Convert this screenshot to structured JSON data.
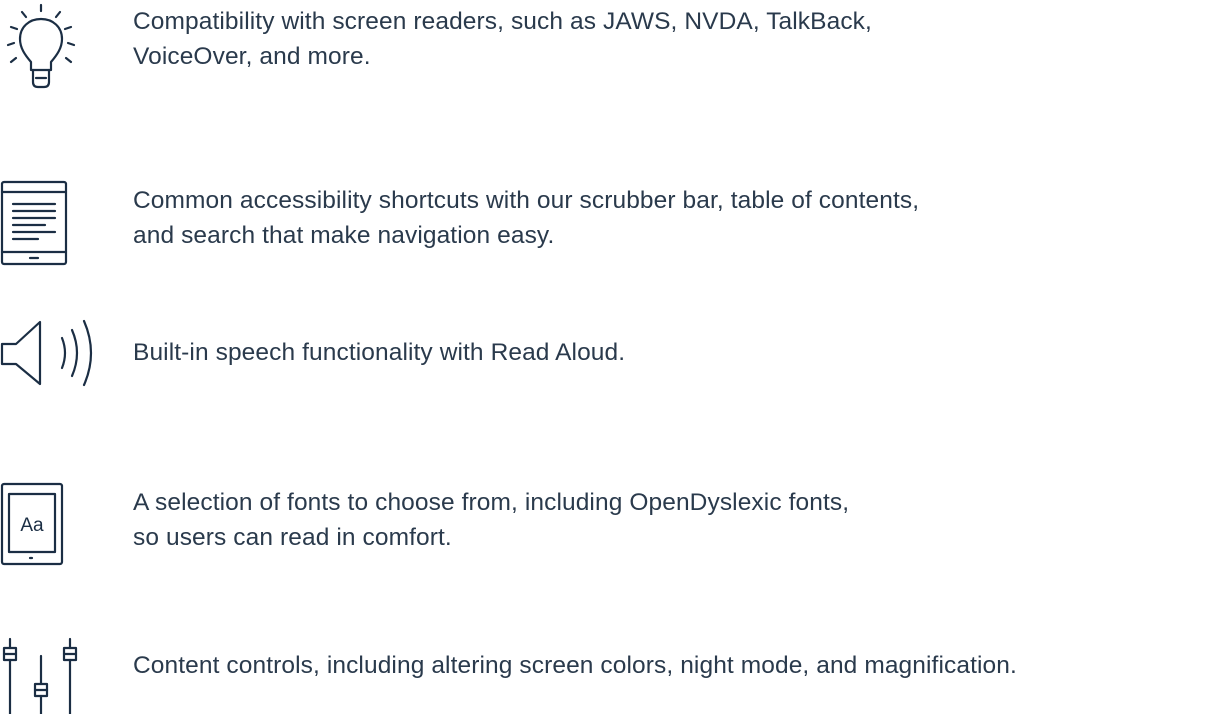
{
  "features": [
    {
      "icon": "lightbulb-icon",
      "lines": [
        "Compatibility with screen readers, such as JAWS, NVDA, TalkBack,",
        "VoiceOver, and more."
      ]
    },
    {
      "icon": "tablet-document-icon",
      "lines": [
        "Common accessibility shortcuts with our scrubber bar, table of contents,",
        "and search that make navigation easy."
      ]
    },
    {
      "icon": "speaker-icon",
      "lines": [
        "Built-in speech functionality with Read Aloud."
      ]
    },
    {
      "icon": "font-tablet-icon",
      "icon_text": "Aa",
      "lines": [
        "A selection of fonts to choose from, including OpenDyslexic fonts,",
        "so users can read in comfort."
      ]
    },
    {
      "icon": "sliders-icon",
      "lines": [
        "Content controls, including altering screen colors, night mode, and magnification."
      ]
    }
  ],
  "colors": {
    "icon_stroke": "#1b2e44",
    "text": "#2a3a4c",
    "background": "#ffffff"
  }
}
